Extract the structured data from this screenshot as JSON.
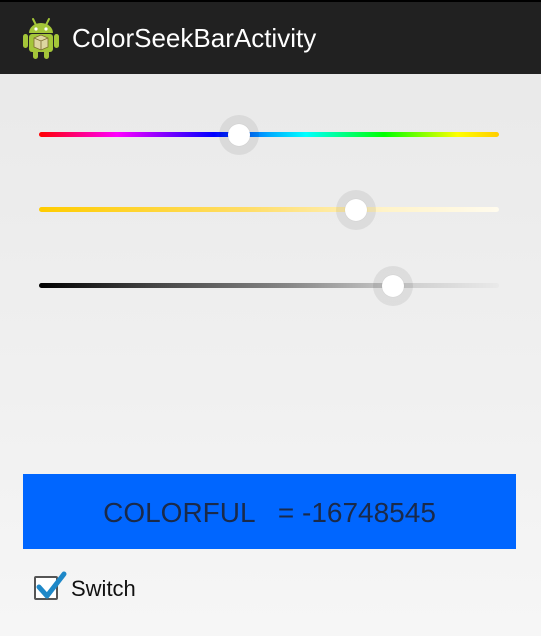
{
  "app": {
    "title": "ColorSeekBarActivity",
    "icon": "android-robot-icon"
  },
  "seekbars": [
    {
      "name": "hue",
      "progress_fraction": 0.435
    },
    {
      "name": "alpha",
      "progress_fraction": 0.69
    },
    {
      "name": "shade",
      "progress_fraction": 0.77
    }
  ],
  "color_panel": {
    "text": "COLORFUL   = -16748545",
    "background": "#0066ff"
  },
  "switch": {
    "label": "Switch",
    "checked": true,
    "check_color": "#1e88c8"
  }
}
